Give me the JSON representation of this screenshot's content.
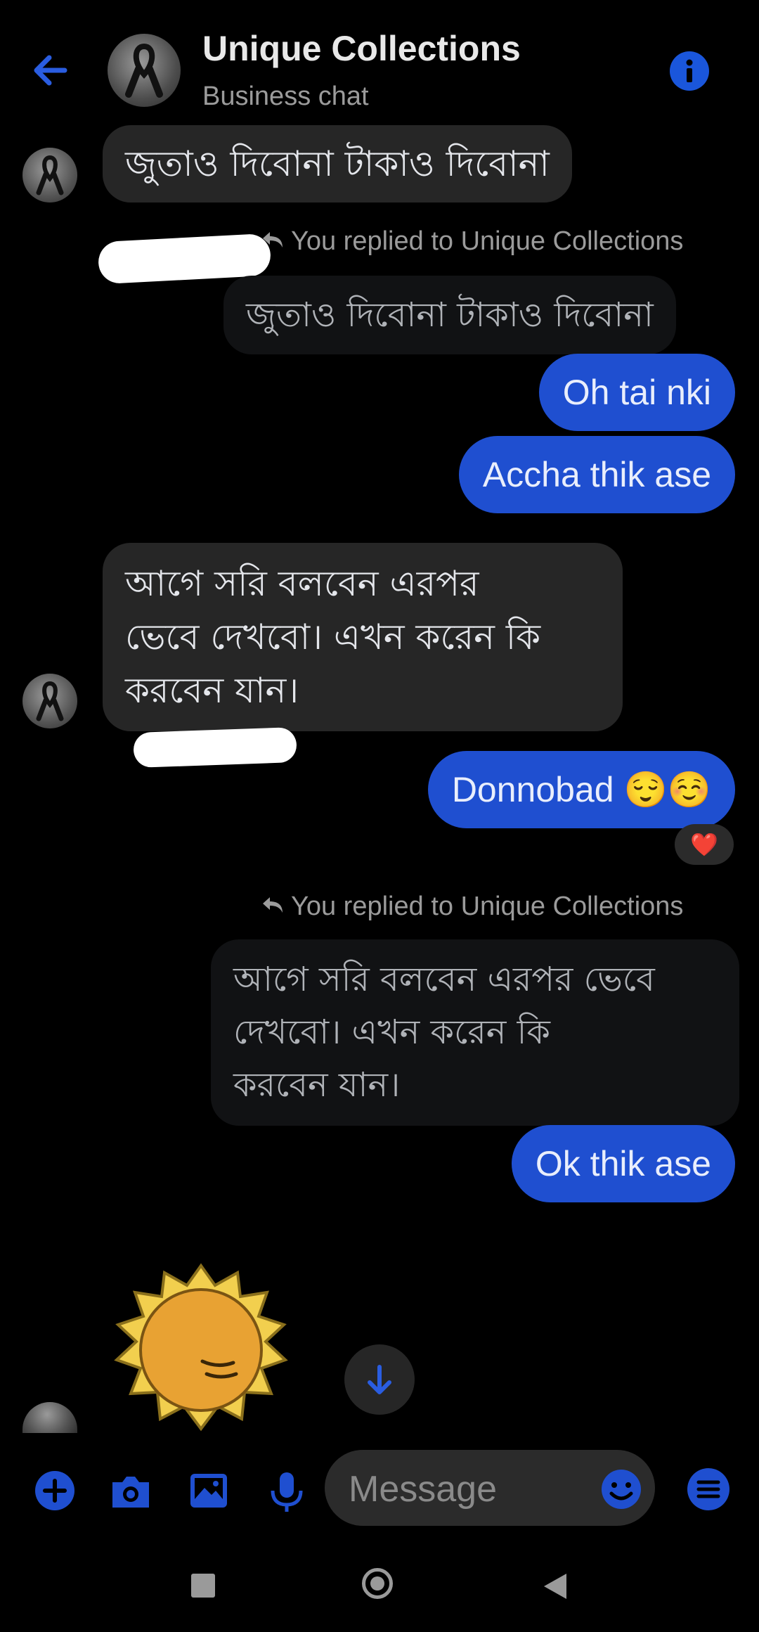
{
  "header": {
    "title": "Unique Collections",
    "subtitle": "Business chat"
  },
  "messages": {
    "m1": "জুতাও দিবোনা টাকাও দিবোনা",
    "replied_label_1": "You replied to Unique Collections",
    "reply_quote_1": "জুতাও দিবোনা টাকাও দিবোনা",
    "m2": "Oh tai nki",
    "m3": "Accha thik ase",
    "m4_line1": "আগে সরি বলবেন এরপর",
    "m4_line2": "ভেবে দেখবো। এখন করেন কি",
    "m4_line3": "করবেন যান।",
    "m5": "Donnobad 😌☺️",
    "m5_reaction": "❤️",
    "replied_label_2": "You replied to Unique Collections",
    "reply_quote_2_line1": "আগে সরি বলবেন এরপর ভেবে",
    "reply_quote_2_line2": "দেখবো। এখন করেন কি",
    "reply_quote_2_line3": "করবেন যান।",
    "m6": "Ok thik ase"
  },
  "composer": {
    "placeholder": "Message"
  },
  "colors": {
    "accent": "#1f4fd0",
    "background": "#000000",
    "incoming_bubble": "#262626"
  },
  "icons": [
    "back-arrow-icon",
    "info-icon",
    "reply-arrow-icon",
    "scroll-down-icon",
    "plus-icon",
    "camera-icon",
    "image-icon",
    "microphone-icon",
    "emoji-icon",
    "menu-icon",
    "nav-square-icon",
    "nav-circle-icon",
    "nav-back-triangle-icon"
  ]
}
